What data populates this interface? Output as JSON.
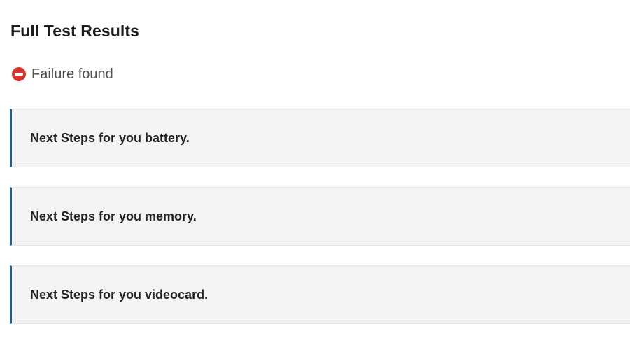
{
  "page": {
    "title": "Full Test Results"
  },
  "status": {
    "icon": "no-entry-icon",
    "icon_color": "#d9342b",
    "text": "Failure found"
  },
  "accent_color": "#1c5f8e",
  "cards": [
    {
      "text": "Next Steps for you battery."
    },
    {
      "text": "Next Steps for you memory."
    },
    {
      "text": "Next Steps for you videocard."
    }
  ]
}
